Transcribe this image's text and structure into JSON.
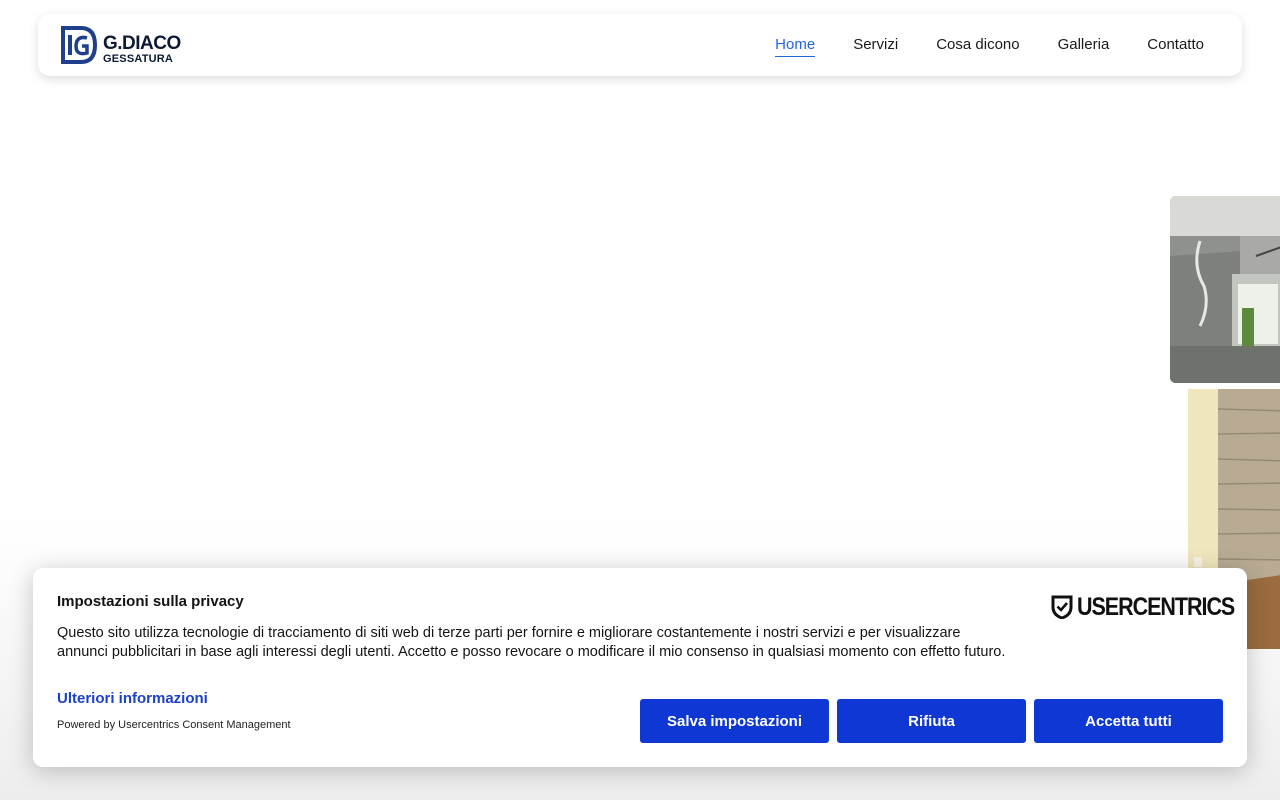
{
  "header": {
    "logo": {
      "line1": "G.DIACO",
      "line2": "GESSATURA",
      "icon": "gd-logo-mark-icon"
    },
    "nav": [
      {
        "label": "Home",
        "active": true
      },
      {
        "label": "Servizi",
        "active": false
      },
      {
        "label": "Cosa dicono",
        "active": false
      },
      {
        "label": "Galleria",
        "active": false
      },
      {
        "label": "Contatto",
        "active": false
      }
    ]
  },
  "gallery": {
    "photos": [
      {
        "subject": "room-under-renovation-photo"
      },
      {
        "subject": "stone-wall-interior-photo"
      }
    ]
  },
  "consent": {
    "title": "Impostazioni sulla privacy",
    "text": "Questo sito utilizza tecnologie di tracciamento di siti web di terze parti per fornire e migliorare costantemente i nostri servizi e per visualizzare annunci pubblicitari in base agli interessi degli utenti. Accetto e posso revocare o modificare il mio consenso in qualsiasi momento con effetto futuro.",
    "more_info": "Ulteriori informazioni",
    "powered_by": "Powered by Usercentrics Consent Management",
    "brand": "USERCENTRICS",
    "brand_icon": "shield-check-icon",
    "buttons": {
      "save": "Salva impostazioni",
      "deny": "Rifiuta",
      "accept": "Accetta tutti"
    }
  },
  "colors": {
    "nav_active": "#2465d8",
    "logo_navy": "#0e1a33",
    "logo_blue": "#1f3f8a",
    "button_blue": "#0f37d3",
    "link_blue": "#1b41c9"
  }
}
